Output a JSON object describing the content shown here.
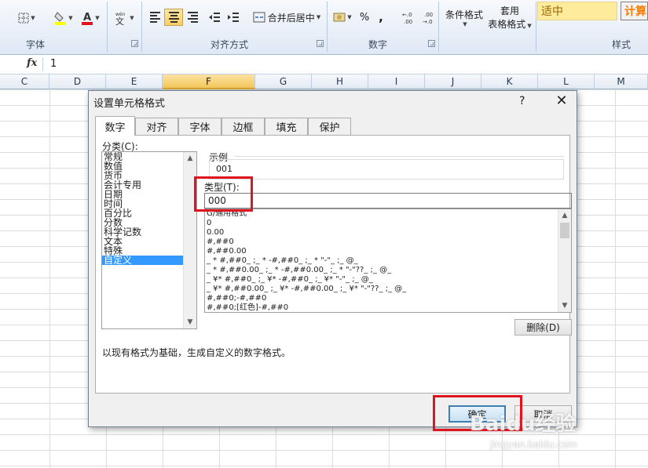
{
  "ribbon": {
    "groups": {
      "font": "字体",
      "alignment": "对齐方式",
      "number": "数字",
      "styles": "样式"
    },
    "merge_center_label": "合并后居中",
    "number_format_symbols": {
      "percent": "%",
      "comma": ",",
      "inc_decimal": "+.0\n.00",
      "dec_decimal": ".00\n→.0"
    },
    "conditional_format_label": "条件格式",
    "table_format_label_1": "套用",
    "table_format_label_2": "表格格式",
    "style_neutral": "适中",
    "style_calc": "计算",
    "accent_colors": {
      "neutral_bg": "#ffeb9c",
      "calc_bg": "#f2f2f2",
      "font_color": "#e0141e",
      "fill_color": "#ffff00"
    }
  },
  "formula_bar": {
    "fx_label": "fx",
    "value": "1"
  },
  "columns": [
    "C",
    "D",
    "E",
    "F",
    "G",
    "H",
    "I",
    "J",
    "K",
    "L",
    "M"
  ],
  "active_column": "F",
  "dialog": {
    "title": "设置单元格格式",
    "help": "?",
    "close": "✕",
    "tabs": [
      "数字",
      "对齐",
      "字体",
      "边框",
      "填充",
      "保护"
    ],
    "active_tab": "数字",
    "category_label": "分类(C):",
    "categories": [
      "常规",
      "数值",
      "货币",
      "会计专用",
      "日期",
      "时间",
      "百分比",
      "分数",
      "科学记数",
      "文本",
      "特殊",
      "自定义"
    ],
    "selected_category": "自定义",
    "sample_label": "示例",
    "sample_value": "001",
    "type_label": "类型(T):",
    "type_value": "000",
    "format_list": [
      "G/通用格式",
      "0",
      "0.00",
      "#,##0",
      "#,##0.00",
      "_ * #,##0_ ;_ * -#,##0_ ;_ * \"-\"_ ;_ @_",
      "_ * #,##0.00_ ;_ * -#,##0.00_ ;_ * \"-\"??_ ;_ @_",
      "_ ¥* #,##0_ ;_ ¥* -#,##0_ ;_ ¥* \"-\"_ ;_ @_",
      "_ ¥* #,##0.00_ ;_ ¥* -#,##0.00_ ;_ ¥* \"-\"??_ ;_ @_",
      "#,##0;-#,##0",
      "#,##0;[红色]-#,##0"
    ],
    "delete_label": "删除(D)",
    "description": "以现有格式为基础，生成自定义的数字格式。",
    "ok_label": "确定",
    "cancel_label": "取消"
  },
  "annotation_color": "#e0141e",
  "watermark": {
    "brand": "Baidu经验",
    "url": "jingyan.baidu.com"
  }
}
